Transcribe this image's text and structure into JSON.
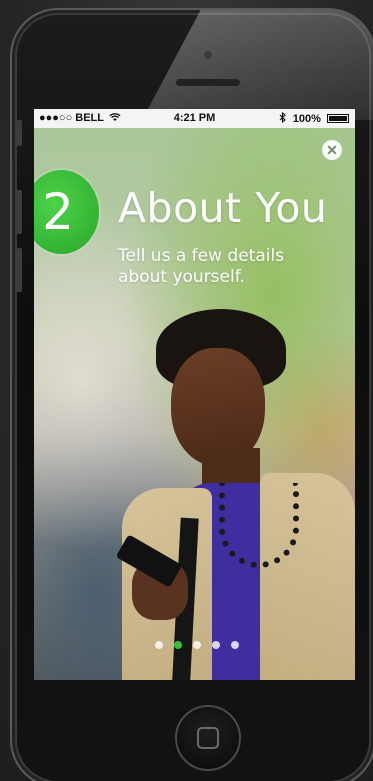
{
  "status_bar": {
    "carrier": "●●●○○ BELL",
    "wifi_icon": "wifi-icon",
    "time": "4:21 PM",
    "bluetooth_icon": "bluetooth-icon",
    "battery_percent": "100%",
    "battery_level": 1.0
  },
  "onboarding": {
    "step_number": "2",
    "title": "About You",
    "subtitle": "Tell us a few details about yourself.",
    "close_icon": "close-icon",
    "accent_color": "#34c234",
    "page_count": 5,
    "active_page": 2
  },
  "close_glyph": "✕"
}
